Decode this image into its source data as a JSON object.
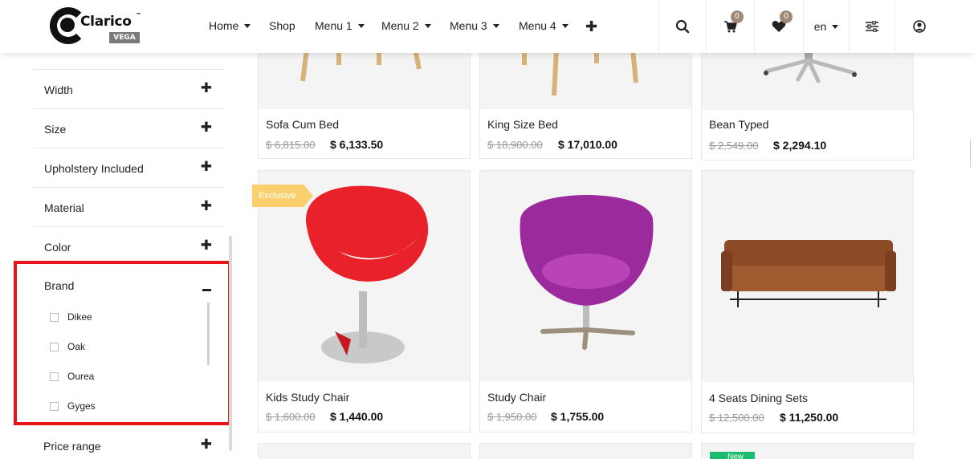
{
  "header": {
    "logo": {
      "brand": "Clarico",
      "tm": "™",
      "sub": "VEGA"
    },
    "nav": [
      {
        "label": "Home",
        "dropdown": true
      },
      {
        "label": "Shop",
        "dropdown": false
      },
      {
        "label": "Menu 1",
        "dropdown": true
      },
      {
        "label": "Menu 2",
        "dropdown": true
      },
      {
        "label": "Menu 3",
        "dropdown": true
      },
      {
        "label": "Menu 4",
        "dropdown": true
      }
    ],
    "more_icon": "plus-icon",
    "search_icon": "search-icon",
    "cart": {
      "icon": "cart-icon",
      "count": "0"
    },
    "wishlist": {
      "icon": "heart-icon",
      "count": "0"
    },
    "language": "en",
    "filter_icon": "sliders-icon",
    "account_icon": "user-circle-icon",
    "badge_color": "#a08a76"
  },
  "sidebar": {
    "filters": [
      {
        "label": "Width",
        "expanded": false
      },
      {
        "label": "Size",
        "expanded": false
      },
      {
        "label": "Upholstery Included",
        "expanded": false
      },
      {
        "label": "Material",
        "expanded": false
      },
      {
        "label": "Color",
        "expanded": false
      },
      {
        "label": "Brand",
        "expanded": true
      },
      {
        "label": "Price range",
        "expanded": false
      }
    ],
    "brands": [
      "Dikee",
      "Oak",
      "Ourea",
      "Gyges"
    ],
    "highlight_color": "#e8141b"
  },
  "products": [
    {
      "name": "Sofa Cum Bed",
      "old_price": "$ 6,815.00",
      "price": "$ 6,133.50"
    },
    {
      "name": "King Size Bed",
      "old_price": "$ 18,900.00",
      "price": "$ 17,010.00"
    },
    {
      "name": "Bean Typed",
      "old_price": "$ 2,549.00",
      "price": "$ 2,294.10"
    },
    {
      "name": "Kids Study Chair",
      "old_price": "$ 1,600.00",
      "price": "$ 1,440.00",
      "tag": "Exclusive"
    },
    {
      "name": "Study Chair",
      "old_price": "$ 1,950.00",
      "price": "$ 1,755.00"
    },
    {
      "name": "4 Seats Dining Sets",
      "old_price": "$ 12,500.00",
      "price": "$ 11,250.00"
    }
  ],
  "tags": {
    "exclusive": "Exclusive",
    "new": "New",
    "exclusive_color": "#fccf6e",
    "new_color": "#1dbb6e"
  }
}
